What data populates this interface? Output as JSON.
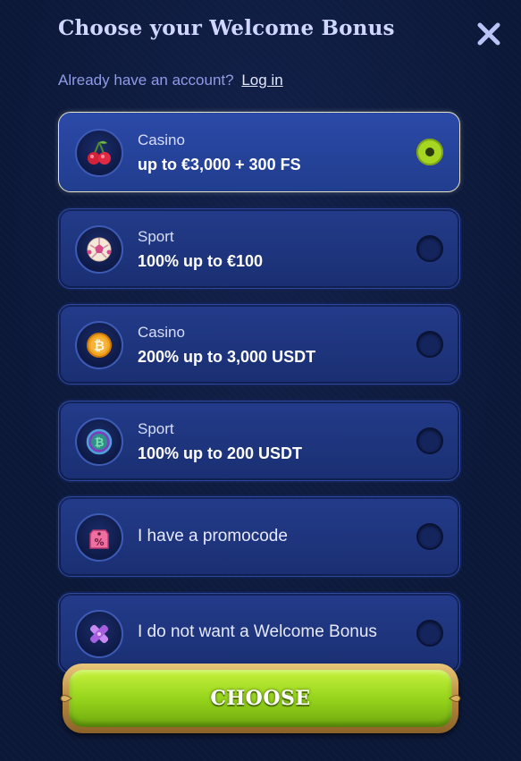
{
  "header": {
    "title": "Choose your Welcome Bonus",
    "close_icon": "close-icon"
  },
  "login": {
    "prompt": "Already have an account?",
    "link_label": "Log in"
  },
  "options": [
    {
      "category": "Casino",
      "amount": "up to €3,000 + 300 FS",
      "icon": "cherries-icon",
      "selected": true
    },
    {
      "category": "Sport",
      "amount": "100% up to €100",
      "icon": "soccer-ball-icon",
      "selected": false
    },
    {
      "category": "Casino",
      "amount": "200% up to 3,000 USDT",
      "icon": "bitcoin-coin-icon",
      "selected": false
    },
    {
      "category": "Sport",
      "amount": "100% up to 200 USDT",
      "icon": "crypto-ball-icon",
      "selected": false
    },
    {
      "label": "I have a promocode",
      "icon": "percent-tag-icon",
      "selected": false
    },
    {
      "label": "I do not want a Welcome Bonus",
      "icon": "crossed-bandage-icon",
      "selected": false
    }
  ],
  "choose_button": {
    "label": "CHOOSE"
  },
  "colors": {
    "background": "#0c1838",
    "card": "#1f3580",
    "selected_border": "#e7e3c8",
    "radio_selected": "#a5d622",
    "button_green": "#92d11a",
    "button_frame": "#b8893e",
    "title": "#cfd6ff"
  }
}
